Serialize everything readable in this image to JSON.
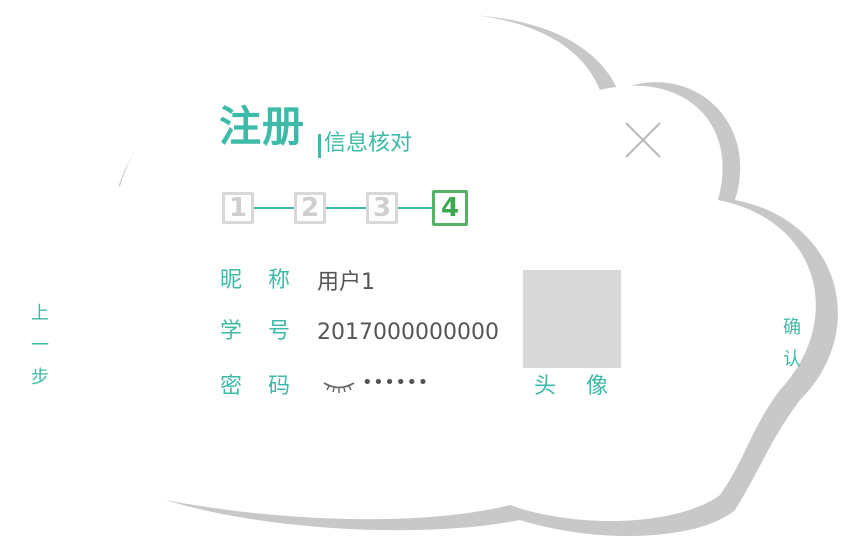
{
  "header": {
    "title": "注册",
    "subtitle": "信息核对"
  },
  "steps": [
    {
      "label": "1",
      "active": false
    },
    {
      "label": "2",
      "active": false
    },
    {
      "label": "3",
      "active": false
    },
    {
      "label": "4",
      "active": true
    }
  ],
  "form": {
    "nickname_label": "昵称",
    "nickname_value": "用户1",
    "student_id_label": "学号",
    "student_id_value": "2017000000000",
    "password_label": "密码",
    "password_masked": "••••••"
  },
  "avatar": {
    "label": "头像"
  },
  "nav": {
    "prev_label": [
      "上",
      "一",
      "步"
    ],
    "confirm_label": [
      "确",
      "认"
    ]
  },
  "icons": {
    "close": "close-icon",
    "password_visibility": "eye-closed-icon"
  },
  "colors": {
    "accent": "#3dbaa8",
    "active_step": "#55b265",
    "inactive_step": "#d8d8d8",
    "shadow": "#c8c8c8"
  }
}
